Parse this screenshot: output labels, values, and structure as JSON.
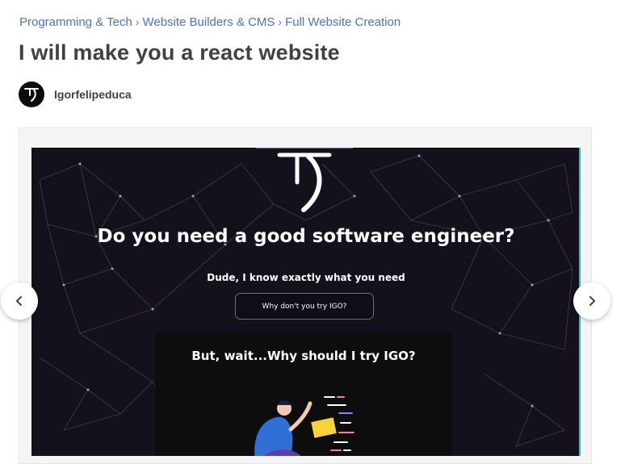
{
  "breadcrumb": {
    "items": [
      "Programming & Tech",
      "Website Builders & CMS",
      "Full Website Creation"
    ],
    "separator": "›"
  },
  "gig": {
    "title": "I will make you a react website"
  },
  "seller": {
    "name": "Igorfelipeduca",
    "avatar_icon": "igo-logo-icon"
  },
  "gallery": {
    "slide": {
      "headline": "Do you need a good software engineer?",
      "subline": "Dude, I know exactly what you need",
      "cta_label": "Why don't you try IGO?",
      "panel_title": "But, wait...Why should I try IGO?",
      "background_color": "#15111c",
      "accent_color": "#25c1c7"
    },
    "prev_icon": "chevron-left-icon",
    "next_icon": "chevron-right-icon"
  },
  "colors": {
    "link": "#4a73c9",
    "title": "#404145"
  }
}
